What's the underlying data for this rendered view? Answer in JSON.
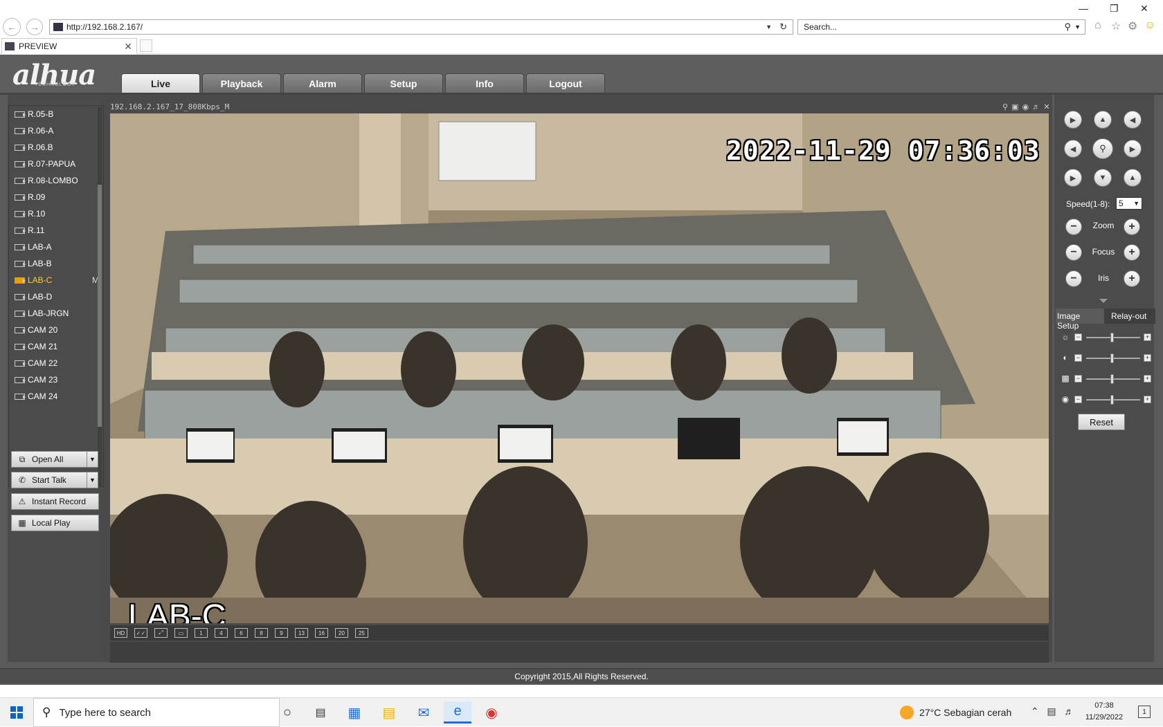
{
  "browser": {
    "url": "http://192.168.2.167/",
    "search_placeholder": "Search...",
    "tab_title": "PREVIEW"
  },
  "app": {
    "logo": "alhua",
    "logo_sub": "TECHNOLOGY",
    "nav": [
      "Live",
      "Playback",
      "Alarm",
      "Setup",
      "Info",
      "Logout"
    ],
    "active_nav": "Live"
  },
  "cameras": [
    {
      "name": "R.05-B"
    },
    {
      "name": "R.06-A"
    },
    {
      "name": "R.06.B"
    },
    {
      "name": "R.07-PAPUA"
    },
    {
      "name": "R.08-LOMBO"
    },
    {
      "name": "R.09"
    },
    {
      "name": "R.10"
    },
    {
      "name": "R.11"
    },
    {
      "name": "LAB-A"
    },
    {
      "name": "LAB-B"
    },
    {
      "name": "LAB-C",
      "selected": true,
      "flag": "M"
    },
    {
      "name": "LAB-D"
    },
    {
      "name": "LAB-JRGN"
    },
    {
      "name": "CAM 20"
    },
    {
      "name": "CAM 21"
    },
    {
      "name": "CAM 22"
    },
    {
      "name": "CAM 23"
    },
    {
      "name": "CAM 24"
    }
  ],
  "controls": {
    "open_all": "Open All",
    "start_talk": "Start Talk",
    "instant_record": "Instant Record",
    "local_play": "Local Play"
  },
  "video": {
    "stream_title": "192.168.2.167_17_808Kbps_M",
    "timestamp": "2022-11-29  07:36:03",
    "camera_overlay": "LAB-C"
  },
  "layout_buttons": [
    "HD",
    "✓✓",
    "⤢",
    "▭",
    "1",
    "4",
    "6",
    "8",
    "9",
    "13",
    "16",
    "20",
    "25"
  ],
  "ptz": {
    "speed_label": "Speed(1-8):",
    "speed_value": "5",
    "zoom_label": "Zoom",
    "focus_label": "Focus",
    "iris_label": "Iris"
  },
  "image_setup": {
    "tab1": "Image Setup",
    "tab2": "Relay-out",
    "reset": "Reset"
  },
  "footer": "Copyright 2015,All Rights Reserved.",
  "taskbar": {
    "search_placeholder": "Type here to search",
    "weather": "27°C  Sebagian cerah",
    "time": "07:38",
    "date": "11/29/2022",
    "notifications": "1"
  }
}
